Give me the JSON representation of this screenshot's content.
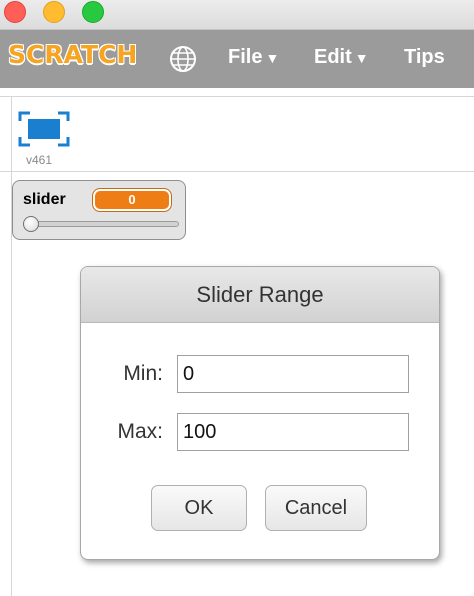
{
  "window": {
    "controls": [
      "close",
      "minimize",
      "zoom"
    ]
  },
  "menubar": {
    "logo": "SCRATCH",
    "language_icon": "globe-icon",
    "items": [
      {
        "label": "File",
        "caret": "▼"
      },
      {
        "label": "Edit",
        "caret": "▼"
      },
      {
        "label": "Tips"
      }
    ]
  },
  "stage": {
    "fullscreen_icon": "fullscreen-icon",
    "version": "v461"
  },
  "monitor": {
    "label": "slider",
    "value": "0",
    "slider_fraction": 0
  },
  "dialog": {
    "title": "Slider Range",
    "min_label": "Min:",
    "min_value": "0",
    "max_label": "Max:",
    "max_value": "100",
    "ok_label": "OK",
    "cancel_label": "Cancel"
  },
  "colors": {
    "menubar": "#9b9b9b",
    "logo": "#f7a520",
    "monitor_value": "#ee7d16",
    "fullscreen_icon": "#1b7fd0"
  }
}
